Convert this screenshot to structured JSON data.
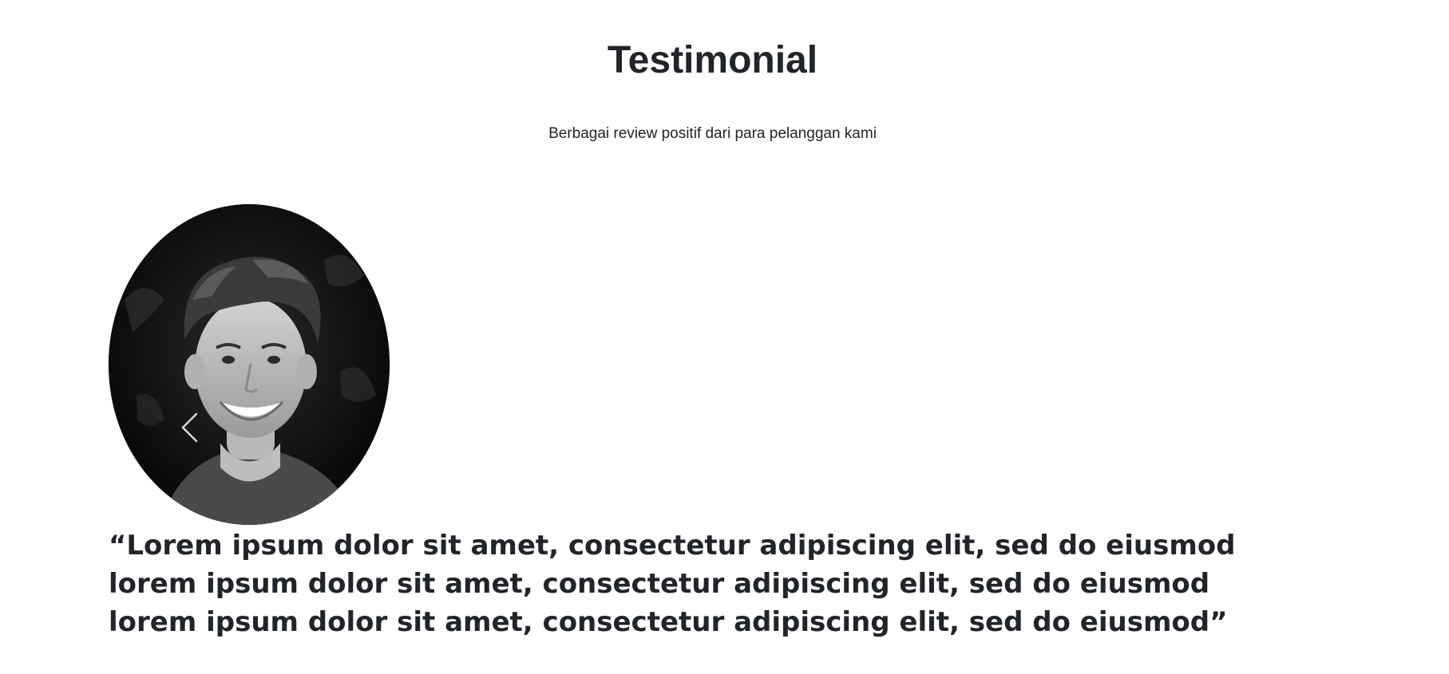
{
  "header": {
    "title": "Testimonial",
    "subtitle": "Berbagai review positif dari para pelanggan kami"
  },
  "carousel": {
    "quote": "“Lorem ipsum dolor sit amet, consectetur adipiscing elit, sed do eiusmod lorem ipsum dolor sit amet, consectetur adipiscing elit, sed do eiusmod lorem ipsum dolor sit amet, consectetur adipiscing elit, sed do eiusmod”",
    "avatar_image": "smiling-young-man-photo",
    "prev_icon": "chevron-left-icon"
  },
  "colors": {
    "text": "#212529",
    "background": "#ffffff",
    "control": "#d9d9d9"
  }
}
